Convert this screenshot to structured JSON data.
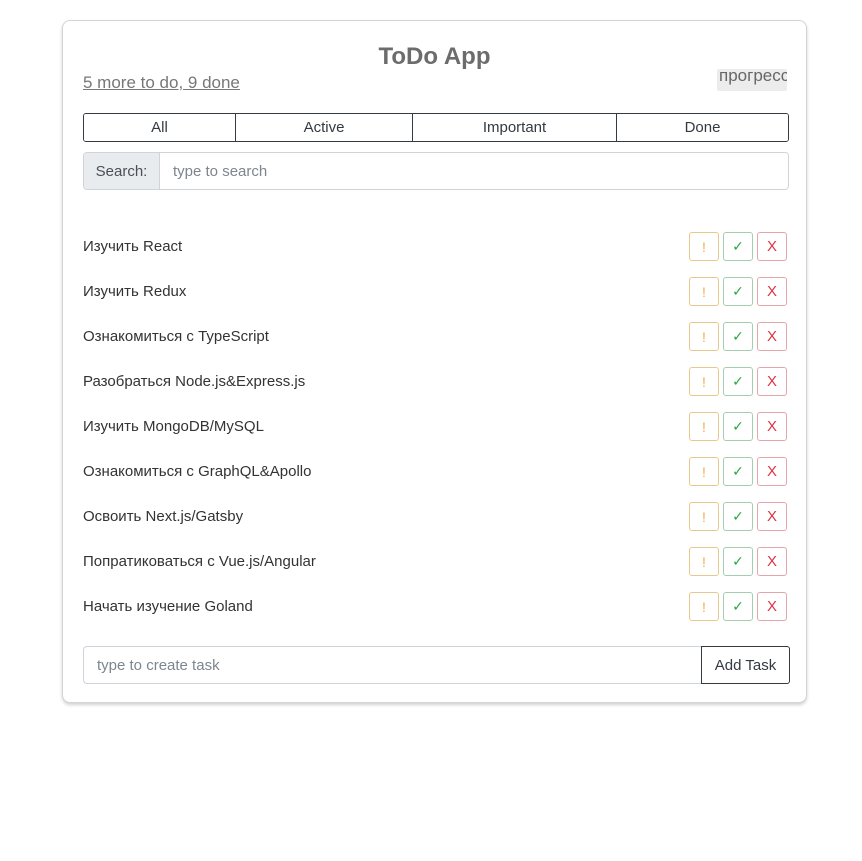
{
  "app": {
    "title": "ToDo App",
    "counter": "5 more to do, 9 done",
    "progress_label": "прогресс"
  },
  "filters": [
    "All",
    "Active",
    "Important",
    "Done"
  ],
  "search": {
    "label": "Search:",
    "placeholder": "type to search",
    "value": ""
  },
  "tasks": [
    "Изучить React",
    "Изучить Redux",
    "Ознакомиться с TypeScript",
    "Разобраться Node.js&Express.js",
    "Изучить MongoDB/MySQL",
    "Ознакомиться с GraphQL&Apollo",
    "Освоить Next.js/Gatsby",
    "Попратиковаться с Vue.js/Angular",
    "Начать изучение Goland"
  ],
  "task_actions": {
    "important": "!",
    "done": "✓",
    "delete": "X"
  },
  "add_task": {
    "placeholder": "type to create task",
    "value": "",
    "button_label": "Add Task"
  },
  "colors": {
    "important": "#f0ad4e",
    "done": "#28a745",
    "delete": "#dc3545",
    "outline": "#343a40"
  }
}
